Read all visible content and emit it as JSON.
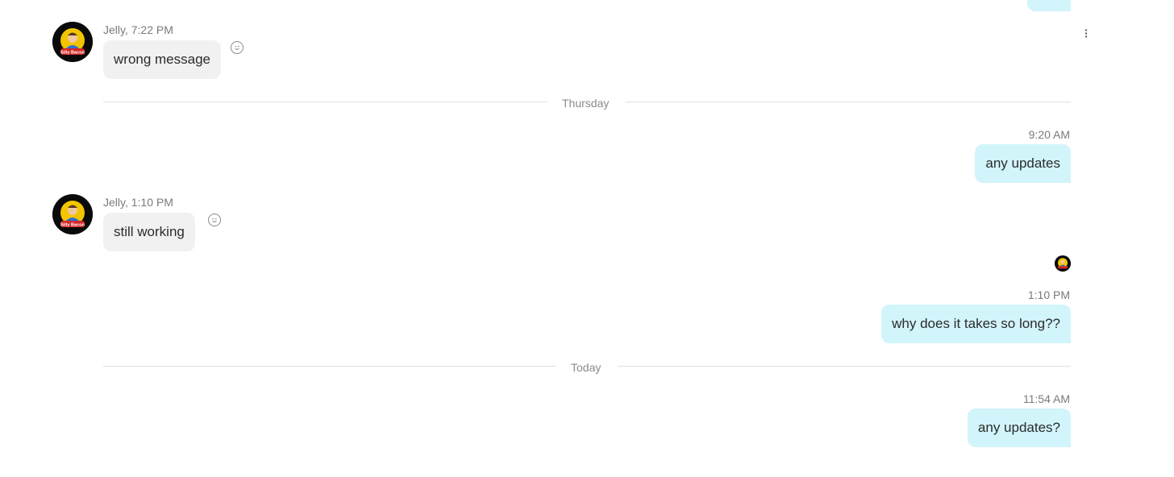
{
  "messages": [
    {
      "sender_meta": "Jelly, 7:22 PM",
      "text": "wrong message"
    },
    {
      "sender_meta": "Jelly, 1:10 PM",
      "text": "still working"
    }
  ],
  "dividers": [
    "Thursday",
    "Today"
  ],
  "outgoing": [
    {
      "time": "9:20 AM",
      "text": "any updates"
    },
    {
      "time": "1:10 PM",
      "text": "why does it takes so long??"
    },
    {
      "time": "11:54 AM",
      "text": "any updates?"
    }
  ],
  "avatar_logo_text": "Silly Bacon",
  "icons": {
    "reaction": "smiley-icon",
    "more": "more-vertical-icon"
  },
  "colors": {
    "incoming_bubble": "#f1f1f1",
    "outgoing_bubble": "#d2f4fb",
    "avatar_bg": "#0a0a0a"
  }
}
